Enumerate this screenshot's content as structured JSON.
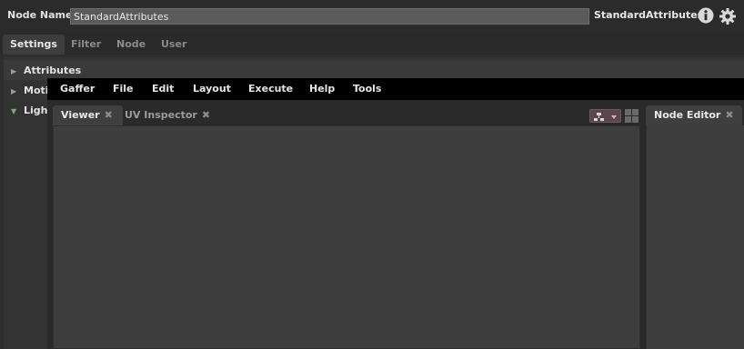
{
  "node_header": {
    "name_label": "Node Name",
    "name_value": "StandardAttributes",
    "node_type": "StandardAttributes",
    "info_icon": "info-icon",
    "settings_icon": "gear-icon"
  },
  "settings_tabs": [
    {
      "label": "Settings",
      "active": true
    },
    {
      "label": "Filter",
      "active": false
    },
    {
      "label": "Node",
      "active": false
    },
    {
      "label": "User",
      "active": false
    }
  ],
  "sections": [
    {
      "label": "Attributes",
      "expanded": false
    },
    {
      "label": "Moti",
      "expanded": false
    },
    {
      "label": "Ligh",
      "expanded": true
    }
  ],
  "menubar": {
    "items": [
      "Gaffer",
      "File",
      "Edit",
      "Layout",
      "Execute",
      "Help",
      "Tools"
    ]
  },
  "viewer_tabs": [
    {
      "label": "Viewer",
      "active": true,
      "close": "✖"
    },
    {
      "label": "UV Inspector",
      "active": false,
      "close": "✖"
    }
  ],
  "right_tabs": [
    {
      "label": "Node Editor",
      "active": true,
      "close": "✖"
    }
  ],
  "colors": {
    "accent_open_triangle": "#6fb36f",
    "layout_button": "#5c454d"
  }
}
